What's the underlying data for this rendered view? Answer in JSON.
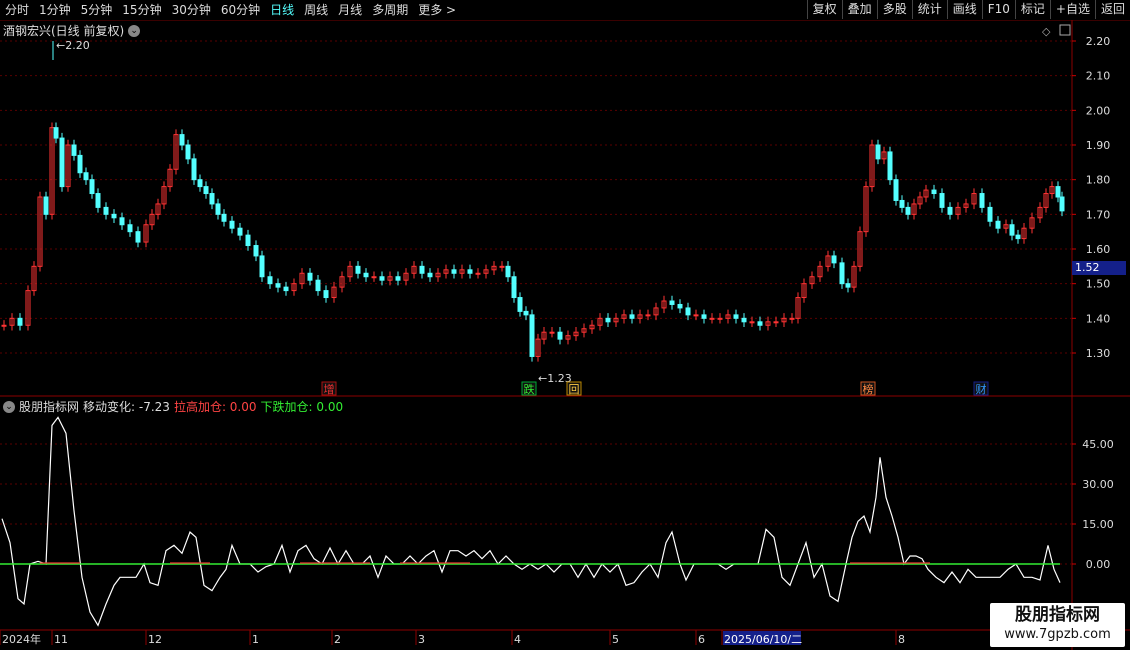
{
  "toolbar": {
    "periods": [
      "分时",
      "1分钟",
      "5分钟",
      "15分钟",
      "30分钟",
      "60分钟",
      "日线",
      "周线",
      "月线",
      "多周期",
      "更多 >"
    ],
    "active_period": "日线",
    "tools": [
      "复权",
      "叠加",
      "多股",
      "统计",
      "画线",
      "F10",
      "标记",
      "+自选",
      "返回"
    ]
  },
  "main_chart": {
    "title": "酒钢宏兴(日线 前复权)",
    "y_ticks": [
      "2.20",
      "2.10",
      "2.00",
      "1.90",
      "1.80",
      "1.70",
      "1.60",
      "1.50",
      "1.40",
      "1.30"
    ],
    "current_price": "1.52",
    "high_label": "2.20",
    "low_label": "1.23",
    "markers": [
      {
        "text": "增",
        "color": "#e33"
      },
      {
        "text": "跌",
        "color": "#3e3"
      },
      {
        "text": "回",
        "color": "#fc4"
      },
      {
        "text": "榜",
        "color": "#f84"
      },
      {
        "text": "财",
        "color": "#39f"
      }
    ],
    "colors": {
      "up": "#ff3333",
      "down": "#54ffff",
      "grid": "#5a0000"
    }
  },
  "sub_chart": {
    "name": "股朋指标网",
    "moving_change_label": "移动变化: -7.23",
    "rise_label": "拉高加仓: 0.00",
    "fall_label": "下跌加仓: 0.00",
    "y_ticks": [
      "45.00",
      "30.00",
      "15.00",
      "0.00"
    ]
  },
  "time_axis": {
    "labels": [
      "2024年",
      "11",
      "12",
      "1",
      "2",
      "3",
      "4",
      "5",
      "6",
      "2025/06/10/二",
      "8"
    ]
  },
  "watermark": {
    "line1": "股朋指标网",
    "line2": "www.7gpzb.com"
  }
}
